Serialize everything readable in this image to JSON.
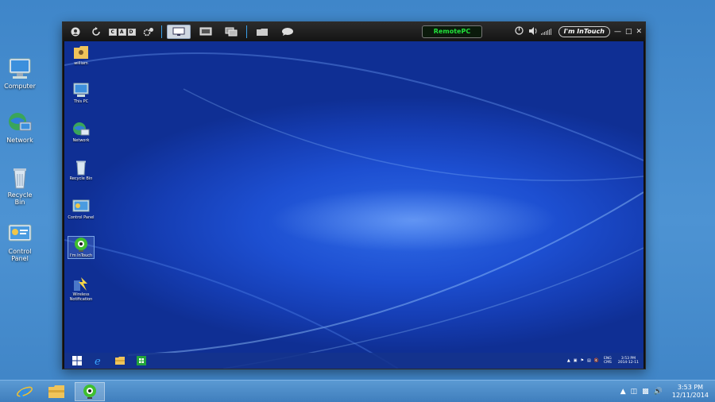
{
  "local_desktop": {
    "icons": [
      {
        "label": "Computer",
        "icon": "computer-icon"
      },
      {
        "label": "Network",
        "icon": "network-icon"
      },
      {
        "label": "Recycle Bin",
        "icon": "recycle-bin-icon"
      },
      {
        "label": "Control Panel",
        "icon": "control-panel-icon"
      }
    ]
  },
  "remote_window": {
    "toolbar": {
      "cad_letters": [
        "C",
        "A",
        "D"
      ],
      "remotepc_label": "RemotePC",
      "logo_text": "I'm InTouch"
    },
    "remote_desktop": {
      "icons": [
        {
          "label": "william",
          "icon": "user-folder-icon"
        },
        {
          "label": "This PC",
          "icon": "this-pc-icon"
        },
        {
          "label": "Network",
          "icon": "network-icon"
        },
        {
          "label": "Recycle Bin",
          "icon": "recycle-bin-icon"
        },
        {
          "label": "Control Panel",
          "icon": "control-panel-icon"
        },
        {
          "label": "I'm InTouch",
          "icon": "intouch-app-icon"
        },
        {
          "label": "Wireless Notification",
          "icon": "wireless-notification-icon"
        }
      ],
      "taskbar": {
        "lang_line1": "ENG",
        "lang_line2": "CMS",
        "time": "3:53 PM",
        "date": "2014-12-11"
      }
    }
  },
  "local_taskbar": {
    "apps": [
      "internet-explorer-icon",
      "file-explorer-icon",
      "intouch-app-icon"
    ],
    "time": "3:53 PM",
    "date": "12/11/2014"
  },
  "colors": {
    "accent": "#3aa0e8",
    "remotepc_green": "#22e33b",
    "remote_desktop_blue": "#1d4fd1"
  }
}
